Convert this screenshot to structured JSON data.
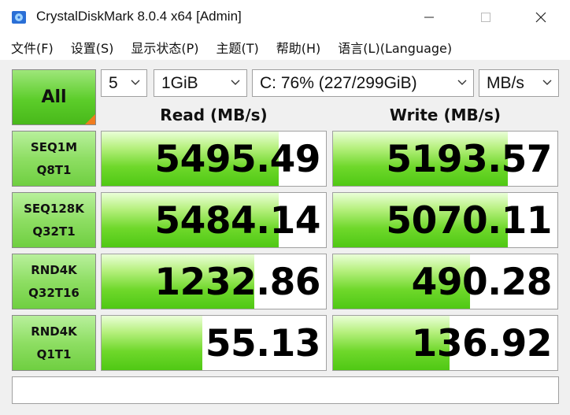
{
  "window": {
    "title": "CrystalDiskMark 8.0.4 x64 [Admin]",
    "app_icon": "crystaldiskmark-icon",
    "controls": {
      "minimize": "minimize-icon",
      "maximize": "maximize-icon",
      "close": "close-icon"
    }
  },
  "menu": [
    "文件(F)",
    "设置(S)",
    "显示状态(P)",
    "主题(T)",
    "帮助(H)",
    "语言(L)(Language)"
  ],
  "toolbar": {
    "all_label": "All",
    "count": "5",
    "size": "1GiB",
    "drive": "C: 76% (227/299GiB)",
    "unit": "MB/s"
  },
  "headers": {
    "read": "Read (MB/s)",
    "write": "Write (MB/s)"
  },
  "tests": [
    {
      "line1": "SEQ1M",
      "line2": "Q8T1",
      "read": "5495.49",
      "write": "5193.57",
      "read_fill": 0.79,
      "write_fill": 0.78
    },
    {
      "line1": "SEQ128K",
      "line2": "Q32T1",
      "read": "5484.14",
      "write": "5070.11",
      "read_fill": 0.79,
      "write_fill": 0.78
    },
    {
      "line1": "RND4K",
      "line2": "Q32T16",
      "read": "1232.86",
      "write": "490.28",
      "read_fill": 0.68,
      "write_fill": 0.61
    },
    {
      "line1": "RND4K",
      "line2": "Q1T1",
      "read": "55.13",
      "write": "136.92",
      "read_fill": 0.45,
      "write_fill": 0.52
    }
  ],
  "comment": "",
  "colors": {
    "accent_green": "#5ccd2a",
    "corner_orange": "#f07d1f"
  }
}
